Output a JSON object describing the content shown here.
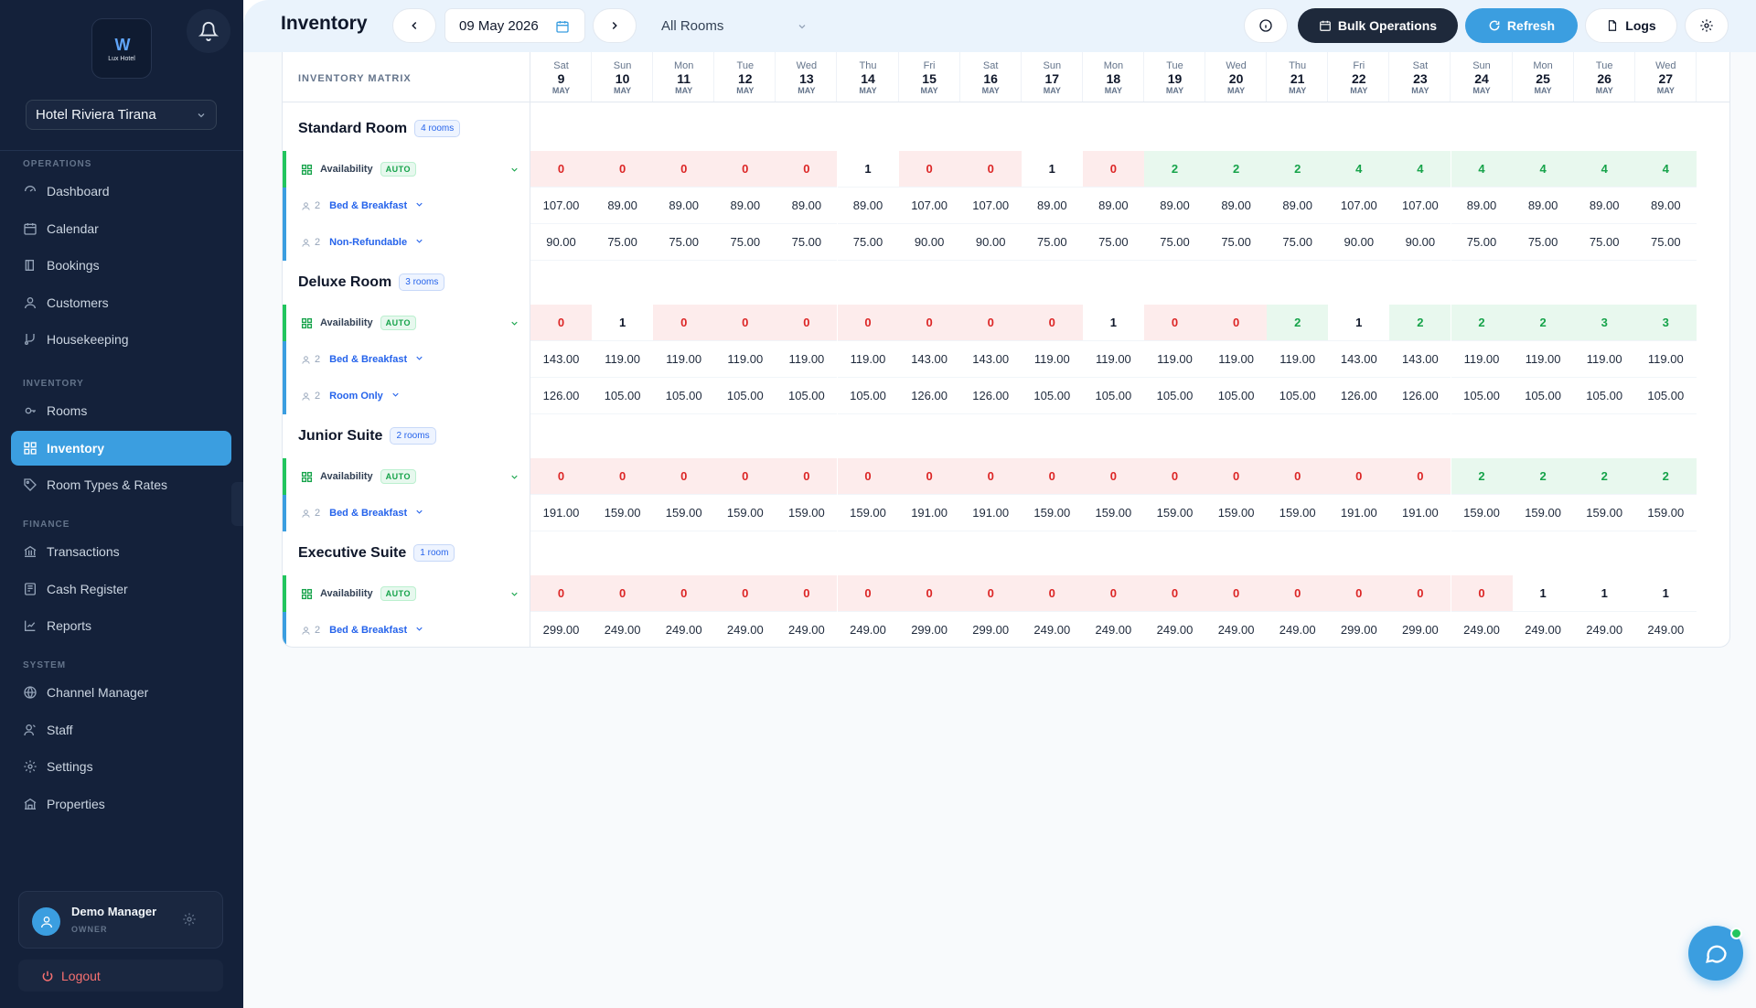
{
  "sidebar": {
    "hotel_name": "Hotel Riviera Tirana",
    "logo_text": "Lux Hotel",
    "sections": [
      {
        "label": "OPERATIONS",
        "items": [
          {
            "label": "Dashboard",
            "icon": "dashboard-icon"
          },
          {
            "label": "Calendar",
            "icon": "calendar-icon"
          },
          {
            "label": "Bookings",
            "icon": "book-icon"
          },
          {
            "label": "Customers",
            "icon": "user-icon"
          },
          {
            "label": "Housekeeping",
            "icon": "broom-icon"
          }
        ]
      },
      {
        "label": "INVENTORY",
        "items": [
          {
            "label": "Rooms",
            "icon": "key-icon"
          },
          {
            "label": "Inventory",
            "icon": "grid-icon",
            "active": true
          },
          {
            "label": "Room Types & Rates",
            "icon": "tag-icon"
          }
        ]
      },
      {
        "label": "FINANCE",
        "items": [
          {
            "label": "Transactions",
            "icon": "bank-icon"
          },
          {
            "label": "Cash Register",
            "icon": "register-icon"
          },
          {
            "label": "Reports",
            "icon": "chart-icon"
          }
        ]
      },
      {
        "label": "SYSTEM",
        "items": [
          {
            "label": "Channel Manager",
            "icon": "globe-icon"
          },
          {
            "label": "Staff",
            "icon": "staff-icon"
          },
          {
            "label": "Settings",
            "icon": "gear-icon"
          },
          {
            "label": "Properties",
            "icon": "building-icon"
          }
        ]
      }
    ],
    "user": {
      "name": "Demo Manager",
      "role": "OWNER"
    },
    "logout_label": "Logout"
  },
  "toolbar": {
    "title": "Inventory",
    "date": "09 May 2026",
    "room_filter": "All Rooms",
    "bulk_label": "Bulk Operations",
    "refresh_label": "Refresh",
    "logs_label": "Logs"
  },
  "matrix": {
    "title": "INVENTORY MATRIX",
    "days": [
      {
        "dow": "Sat",
        "day": "9",
        "month": "MAY"
      },
      {
        "dow": "Sun",
        "day": "10",
        "month": "MAY"
      },
      {
        "dow": "Mon",
        "day": "11",
        "month": "MAY"
      },
      {
        "dow": "Tue",
        "day": "12",
        "month": "MAY"
      },
      {
        "dow": "Wed",
        "day": "13",
        "month": "MAY"
      },
      {
        "dow": "Thu",
        "day": "14",
        "month": "MAY"
      },
      {
        "dow": "Fri",
        "day": "15",
        "month": "MAY"
      },
      {
        "dow": "Sat",
        "day": "16",
        "month": "MAY"
      },
      {
        "dow": "Sun",
        "day": "17",
        "month": "MAY"
      },
      {
        "dow": "Mon",
        "day": "18",
        "month": "MAY"
      },
      {
        "dow": "Tue",
        "day": "19",
        "month": "MAY"
      },
      {
        "dow": "Wed",
        "day": "20",
        "month": "MAY"
      },
      {
        "dow": "Thu",
        "day": "21",
        "month": "MAY"
      },
      {
        "dow": "Fri",
        "day": "22",
        "month": "MAY"
      },
      {
        "dow": "Sat",
        "day": "23",
        "month": "MAY"
      },
      {
        "dow": "Sun",
        "day": "24",
        "month": "MAY"
      },
      {
        "dow": "Mon",
        "day": "25",
        "month": "MAY"
      },
      {
        "dow": "Tue",
        "day": "26",
        "month": "MAY"
      },
      {
        "dow": "Wed",
        "day": "27",
        "month": "MAY"
      }
    ],
    "availability_label": "Availability",
    "auto_label": "AUTO",
    "rooms": [
      {
        "name": "Standard Room",
        "count": "4 rooms",
        "availability": [
          0,
          0,
          0,
          0,
          0,
          1,
          0,
          0,
          1,
          0,
          2,
          2,
          2,
          4,
          4,
          4,
          4,
          4,
          4
        ],
        "rates": [
          {
            "occupancy": "2",
            "name": "Bed & Breakfast",
            "values": [
              "107.00",
              "89.00",
              "89.00",
              "89.00",
              "89.00",
              "89.00",
              "107.00",
              "107.00",
              "89.00",
              "89.00",
              "89.00",
              "89.00",
              "89.00",
              "107.00",
              "107.00",
              "89.00",
              "89.00",
              "89.00",
              "89.00"
            ]
          },
          {
            "occupancy": "2",
            "name": "Non-Refundable",
            "values": [
              "90.00",
              "75.00",
              "75.00",
              "75.00",
              "75.00",
              "75.00",
              "90.00",
              "90.00",
              "75.00",
              "75.00",
              "75.00",
              "75.00",
              "75.00",
              "90.00",
              "90.00",
              "75.00",
              "75.00",
              "75.00",
              "75.00"
            ]
          }
        ]
      },
      {
        "name": "Deluxe Room",
        "count": "3 rooms",
        "availability": [
          0,
          1,
          0,
          0,
          0,
          0,
          0,
          0,
          0,
          1,
          0,
          0,
          2,
          1,
          2,
          2,
          2,
          3,
          3
        ],
        "rates": [
          {
            "occupancy": "2",
            "name": "Bed & Breakfast",
            "values": [
              "143.00",
              "119.00",
              "119.00",
              "119.00",
              "119.00",
              "119.00",
              "143.00",
              "143.00",
              "119.00",
              "119.00",
              "119.00",
              "119.00",
              "119.00",
              "143.00",
              "143.00",
              "119.00",
              "119.00",
              "119.00",
              "119.00"
            ]
          },
          {
            "occupancy": "2",
            "name": "Room Only",
            "values": [
              "126.00",
              "105.00",
              "105.00",
              "105.00",
              "105.00",
              "105.00",
              "126.00",
              "126.00",
              "105.00",
              "105.00",
              "105.00",
              "105.00",
              "105.00",
              "126.00",
              "126.00",
              "105.00",
              "105.00",
              "105.00",
              "105.00"
            ]
          }
        ]
      },
      {
        "name": "Junior Suite",
        "count": "2 rooms",
        "availability": [
          0,
          0,
          0,
          0,
          0,
          0,
          0,
          0,
          0,
          0,
          0,
          0,
          0,
          0,
          0,
          2,
          2,
          2,
          2
        ],
        "rates": [
          {
            "occupancy": "2",
            "name": "Bed & Breakfast",
            "values": [
              "191.00",
              "159.00",
              "159.00",
              "159.00",
              "159.00",
              "159.00",
              "191.00",
              "191.00",
              "159.00",
              "159.00",
              "159.00",
              "159.00",
              "159.00",
              "191.00",
              "191.00",
              "159.00",
              "159.00",
              "159.00",
              "159.00"
            ]
          }
        ]
      },
      {
        "name": "Executive Suite",
        "count": "1 room",
        "availability": [
          0,
          0,
          0,
          0,
          0,
          0,
          0,
          0,
          0,
          0,
          0,
          0,
          0,
          0,
          0,
          0,
          1,
          1,
          1
        ],
        "rates": [
          {
            "occupancy": "2",
            "name": "Bed & Breakfast",
            "values": [
              "299.00",
              "249.00",
              "249.00",
              "249.00",
              "249.00",
              "249.00",
              "299.00",
              "299.00",
              "249.00",
              "249.00",
              "249.00",
              "249.00",
              "249.00",
              "299.00",
              "299.00",
              "249.00",
              "249.00",
              "249.00",
              "249.00"
            ]
          }
        ]
      }
    ]
  },
  "colors": {
    "accent": "#3b9ee0",
    "sidebar_bg": "#14213a",
    "zero": "#dc2626",
    "available": "#16a34a"
  }
}
